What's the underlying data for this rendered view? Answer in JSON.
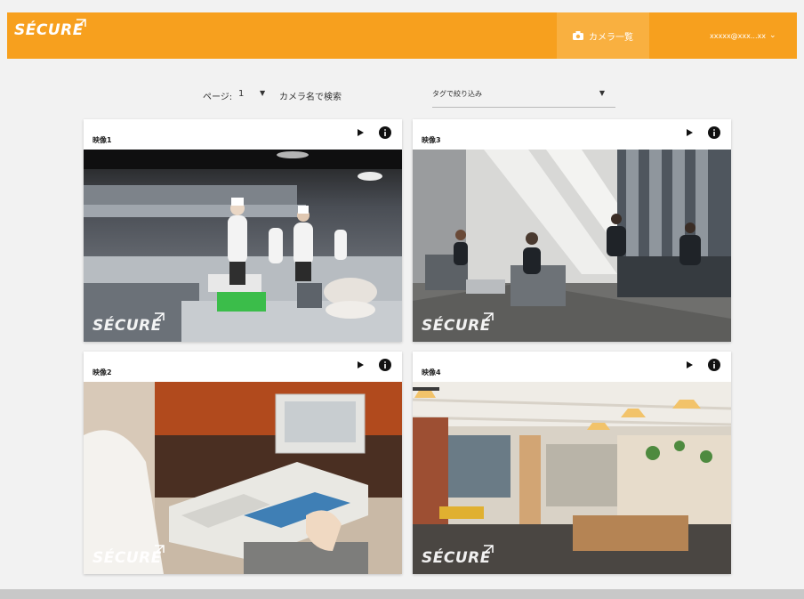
{
  "header": {
    "logo": "SÉCURE",
    "camera_list_label": "カメラ一覧",
    "user_label": "xxxxx@xxx...xx",
    "chevron": "⌄"
  },
  "filters": {
    "page_label": "ページ:",
    "page_value": "1",
    "page_arrow": "▼",
    "search_placeholder": "カメラ名で検索",
    "tag_placeholder": "タグで絞り込み",
    "tag_arrow": "▼"
  },
  "cameras": [
    {
      "title": "映像1",
      "watermark": "SÉCURE"
    },
    {
      "title": "映像3",
      "watermark": "SÉCURE"
    },
    {
      "title": "映像2",
      "watermark": "SÉCURE"
    },
    {
      "title": "映像4",
      "watermark": "SÉCURE"
    }
  ],
  "icons": {
    "camera": "camera-icon",
    "play": "play-icon",
    "info": "info-icon",
    "chevron": "chevron-down-icon"
  },
  "colors": {
    "brand": "#f7a01e",
    "camera_tab": "#f9b040",
    "page_bg": "#f2f2f2"
  }
}
